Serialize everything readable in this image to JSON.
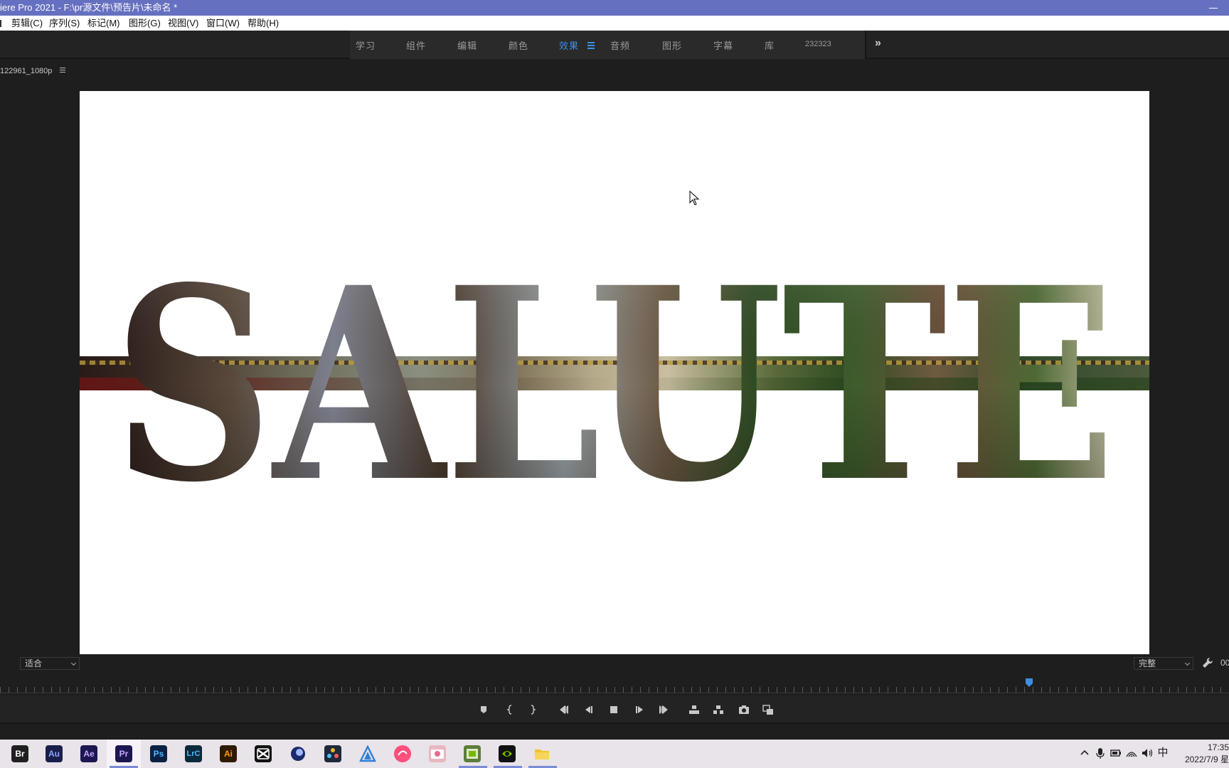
{
  "window": {
    "title": "iere Pro 2021 - F:\\pr源文件\\预告片\\未命名 *"
  },
  "menu": {
    "items": [
      "剪辑(C)",
      "序列(S)",
      "标记(M)",
      "图形(G)",
      "视图(V)",
      "窗口(W)",
      "帮助(H)"
    ]
  },
  "workspaces": {
    "tabs": [
      "学习",
      "组件",
      "编辑",
      "颜色",
      "效果",
      "音频",
      "图形",
      "字幕",
      "库",
      "232323"
    ],
    "active": "效果"
  },
  "monitor": {
    "sequence_name": "122961_1080p",
    "overlay_text": "SALUTE",
    "fit_value": "适合",
    "quality_value": "完整",
    "timecode": "00"
  },
  "colors": {
    "titlebar": "#6670c0",
    "accent": "#3d8fe6",
    "panel_bg": "#1e1e1e"
  },
  "transport": {
    "buttons": [
      "add-marker-icon",
      "mark-in-icon",
      "mark-out-icon",
      "go-to-in-icon",
      "step-back-icon",
      "stop-icon",
      "step-forward-icon",
      "go-to-out-icon",
      "lift-icon",
      "extract-icon",
      "export-frame-icon",
      "compare-view-icon"
    ]
  },
  "taskbar": {
    "apps": [
      {
        "label": "Br",
        "bg": "#1f1f1f",
        "fg": "#ffffff"
      },
      {
        "label": "Au",
        "bg": "#1a1f4a",
        "fg": "#8fa0ff"
      },
      {
        "label": "Ae",
        "bg": "#1c1750",
        "fg": "#c6a7ff"
      },
      {
        "label": "Pr",
        "bg": "#1c1750",
        "fg": "#c6a7ff"
      },
      {
        "label": "Ps",
        "bg": "#0a2144",
        "fg": "#4fb7ff"
      },
      {
        "label": "LrC",
        "bg": "#0c2a3a",
        "fg": "#4fb7ff"
      },
      {
        "label": "Ai",
        "bg": "#2f1a00",
        "fg": "#ff9a00"
      }
    ],
    "clock_time": "17:35",
    "clock_date": "2022/7/9 星",
    "ime": "中"
  }
}
